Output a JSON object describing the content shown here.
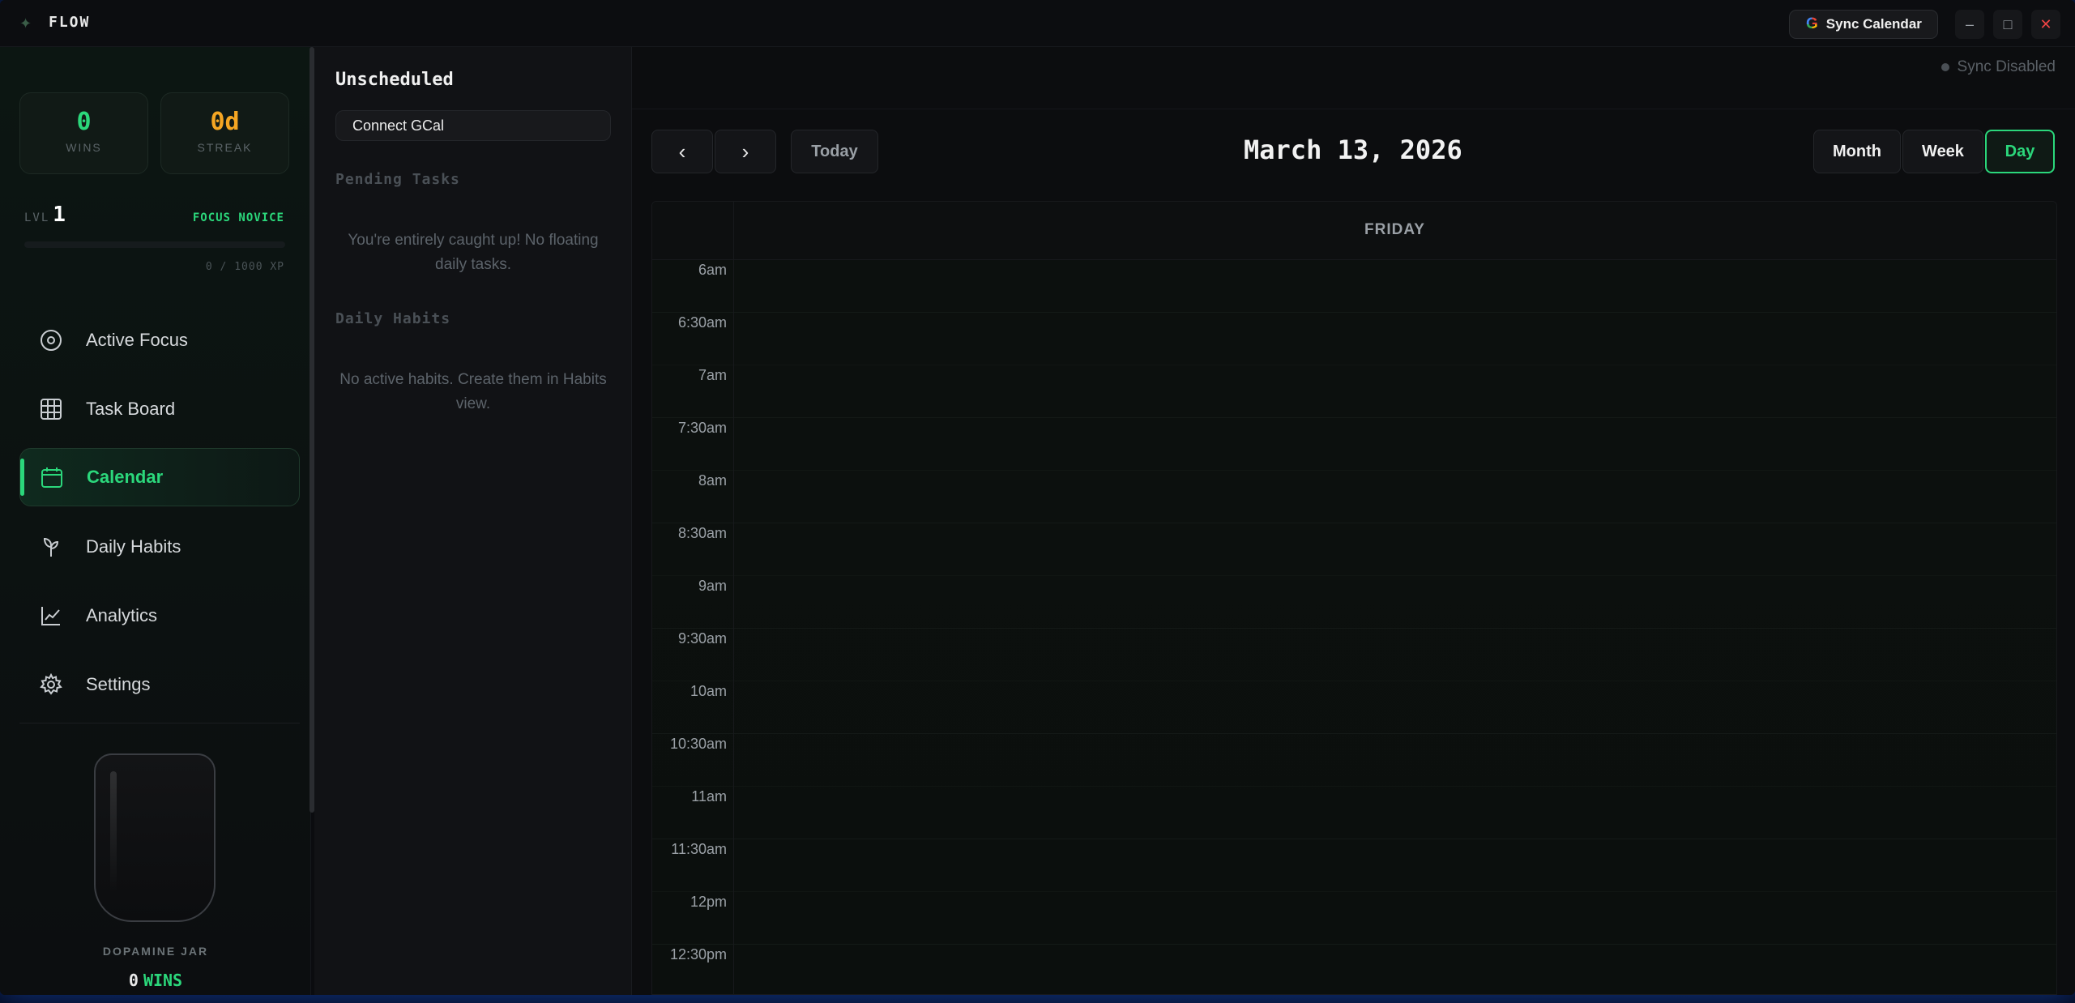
{
  "app": {
    "title": "FLOW",
    "sync_calendar_label": "Sync Calendar"
  },
  "window_controls": {
    "minimize": "–",
    "maximize": "□",
    "close": "✕"
  },
  "stats": {
    "wins_value": "0",
    "wins_label": "WINS",
    "streak_value": "0d",
    "streak_label": "STREAK",
    "colors": {
      "wins": "#2bd77b",
      "streak": "#f5a623"
    }
  },
  "level": {
    "label": "LVL",
    "number": "1",
    "rank": "FOCUS NOVICE",
    "xp_text": "0 / 1000 XP",
    "xp_fraction": 0
  },
  "nav": {
    "items": [
      {
        "label": "Active Focus",
        "icon": "target-icon",
        "active": false
      },
      {
        "label": "Task Board",
        "icon": "grid-icon",
        "active": false
      },
      {
        "label": "Calendar",
        "icon": "calendar-icon",
        "active": true
      },
      {
        "label": "Daily Habits",
        "icon": "sprout-icon",
        "active": false
      },
      {
        "label": "Analytics",
        "icon": "chart-line-icon",
        "active": false
      },
      {
        "label": "Settings",
        "icon": "gear-icon",
        "active": false
      }
    ]
  },
  "jar": {
    "label": "DOPAMINE JAR",
    "wins_count": "0",
    "wins_word": "WINS"
  },
  "unscheduled": {
    "title": "Unscheduled",
    "connect_label": "Connect GCal",
    "pending_heading": "Pending Tasks",
    "pending_empty": "You're entirely caught up! No floating daily tasks.",
    "habits_heading": "Daily Habits",
    "habits_empty": "No active habits. Create them in Habits view."
  },
  "calendar": {
    "sync_status": "Sync Disabled",
    "prev": "‹",
    "next": "›",
    "today_label": "Today",
    "date_title": "March 13, 2026",
    "views": {
      "month": "Month",
      "week": "Week",
      "day": "Day",
      "active": "day"
    },
    "day_name": "FRIDAY",
    "time_slots": [
      "6am",
      "6:30am",
      "7am",
      "7:30am",
      "8am",
      "8:30am",
      "9am",
      "9:30am",
      "10am",
      "10:30am",
      "11am",
      "11:30am",
      "12pm",
      "12:30pm"
    ]
  },
  "accent_color": "#2bd77b"
}
